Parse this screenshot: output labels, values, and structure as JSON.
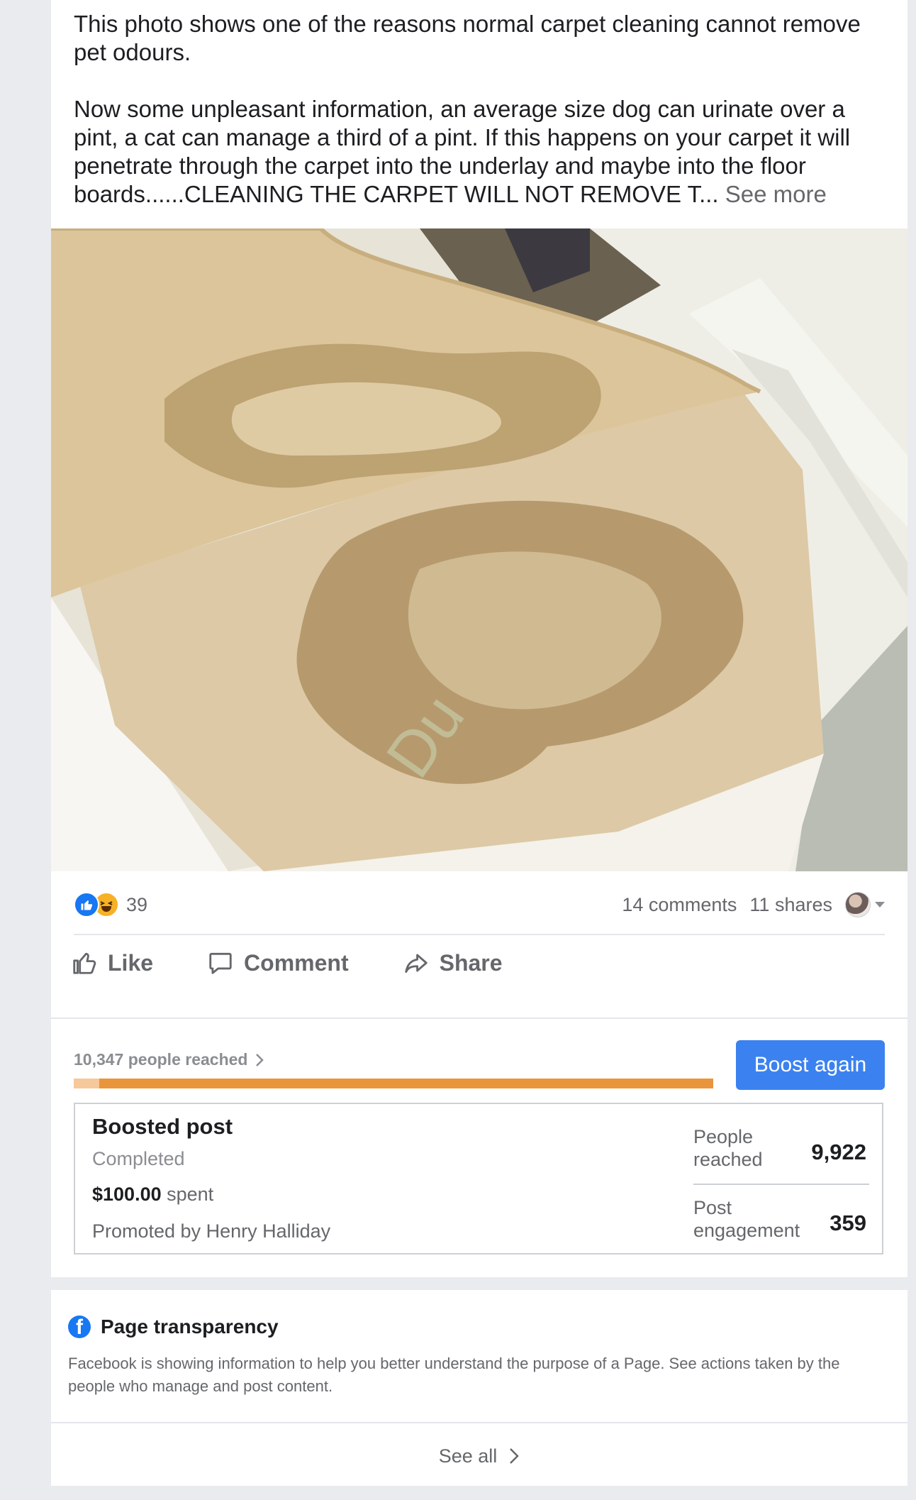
{
  "post": {
    "text_line1": "This photo shows one of the reasons normal carpet cleaning cannot remove pet odours.",
    "text_line2": "Now some unpleasant information,  an average size dog can urinate over a pint, a cat can manage a third of a pint. If this happens on your carpet it will penetrate through the carpet into the underlay and maybe into the floor boards......CLEANING THE CARPET WILL NOT REMOVE T...",
    "see_more": "See more"
  },
  "stats": {
    "reaction_count": "39",
    "comments": "14 comments",
    "shares": "11 shares"
  },
  "actions": {
    "like": "Like",
    "comment": "Comment",
    "share": "Share"
  },
  "boost": {
    "reach_text": "10,347 people reached",
    "reach_progress": 0.04,
    "boost_again": "Boost again",
    "title": "Boosted post",
    "status": "Completed",
    "amount": "$100.00",
    "spent_label": "spent",
    "promoted_by": "Promoted by Henry Halliday",
    "people_reached_label": "People reached",
    "people_reached_value": "9,922",
    "engagement_label": "Post engagement",
    "engagement_value": "359"
  },
  "transparency": {
    "title": "Page transparency",
    "description": "Facebook is showing information to help you better understand the purpose of a Page. See actions taken by the people who manage and post content.",
    "see_all": "See all"
  },
  "colors": {
    "boost_button": "#3b82f0",
    "progress_bar": "#e9953b",
    "facebook_blue": "#1877f2"
  },
  "icons": [
    "like-reaction-icon",
    "haha-reaction-icon",
    "thumbs-up-icon",
    "comment-bubble-icon",
    "share-arrow-icon",
    "chevron-right-icon",
    "facebook-logo-icon",
    "dropdown-caret-icon"
  ]
}
